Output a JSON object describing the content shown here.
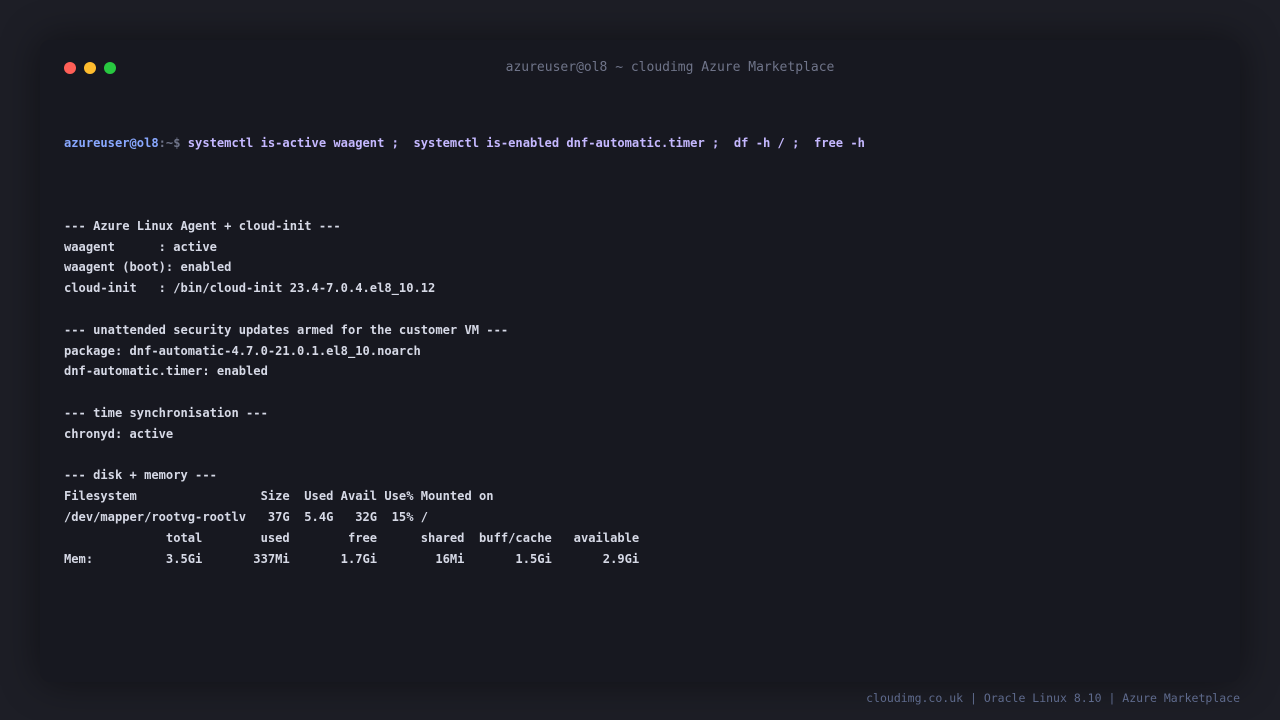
{
  "window": {
    "title": "azureuser@ol8 ~ cloudimg Azure Marketplace",
    "controls": [
      "close",
      "minimize",
      "maximize"
    ]
  },
  "terminal": {
    "prompt_user": "azureuser@ol8",
    "prompt_path": ":~$ ",
    "command": "systemctl is-active waagent ;  systemctl is-enabled dnf-automatic.timer ;  df -h / ;  free -h",
    "output": [
      "",
      "--- Azure Linux Agent + cloud-init ---",
      "waagent      : active",
      "waagent (boot): enabled",
      "cloud-init   : /bin/cloud-init 23.4-7.0.4.el8_10.12",
      "",
      "--- unattended security updates armed for the customer VM ---",
      "package: dnf-automatic-4.7.0-21.0.1.el8_10.noarch",
      "dnf-automatic.timer: enabled",
      "",
      "--- time synchronisation ---",
      "chronyd: active",
      "",
      "--- disk + memory ---",
      "Filesystem                 Size  Used Avail Use% Mounted on",
      "/dev/mapper/rootvg-rootlv   37G  5.4G   32G  15% /",
      "              total        used        free      shared  buff/cache   available",
      "Mem:          3.5Gi       337Mi       1.7Gi        16Mi       1.5Gi       2.9Gi"
    ]
  },
  "footer": "cloudimg.co.uk | Oracle Linux 8.10 | Azure Marketplace",
  "colors": {
    "page_bg": "#1d1e26",
    "terminal_bg": "#171820",
    "text": "#d6d9e6",
    "prompt_user": "#89a8ff",
    "command": "#c5b8ff",
    "close": "#ff5f57",
    "minimize": "#febc2e",
    "maximize": "#28c840"
  }
}
